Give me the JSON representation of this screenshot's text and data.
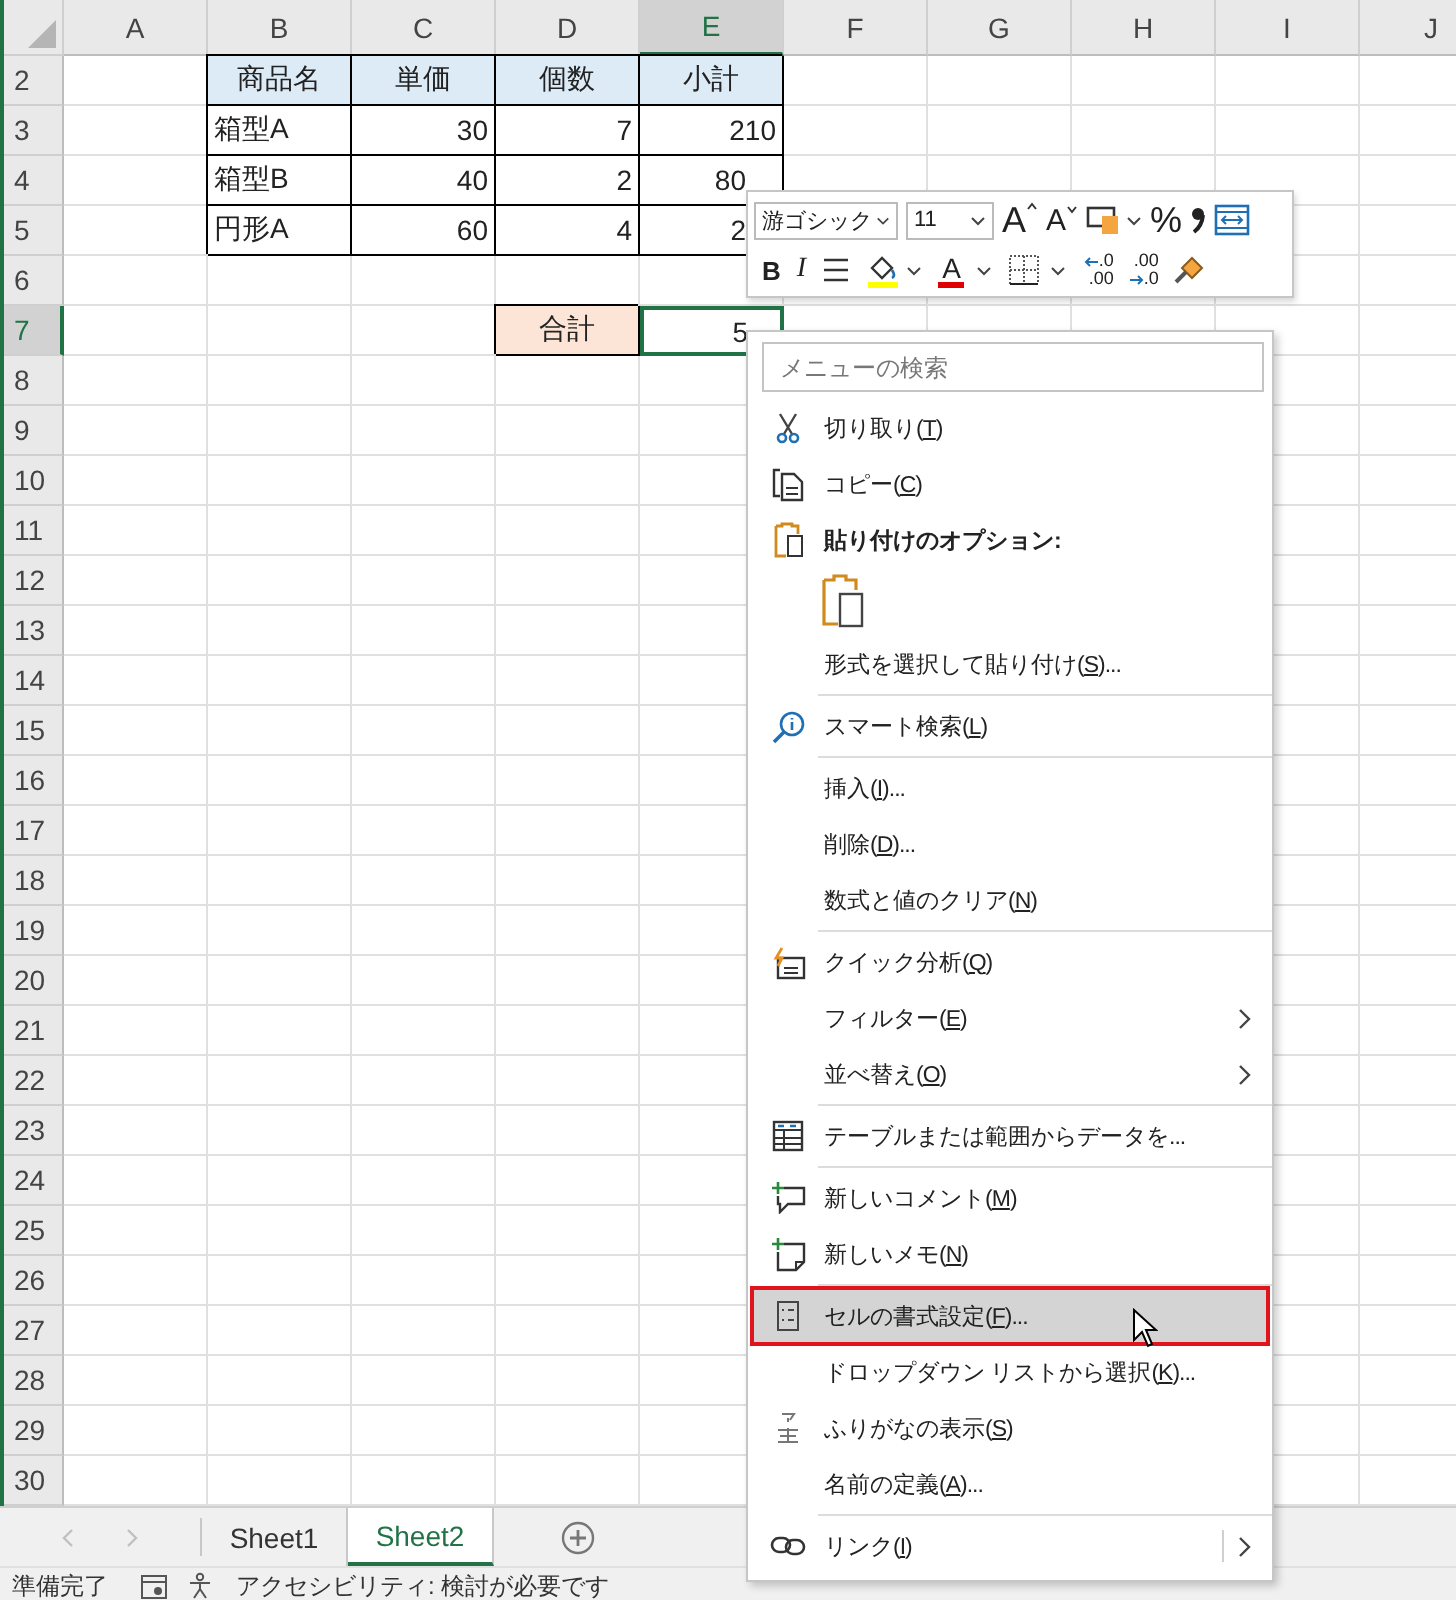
{
  "sheet": {
    "columns": [
      {
        "label": "A",
        "selected": false
      },
      {
        "label": "B",
        "selected": false
      },
      {
        "label": "C",
        "selected": false
      },
      {
        "label": "D",
        "selected": false
      },
      {
        "label": "E",
        "selected": true
      },
      {
        "label": "F",
        "selected": false
      },
      {
        "label": "G",
        "selected": false
      },
      {
        "label": "H",
        "selected": false
      },
      {
        "label": "I",
        "selected": false
      },
      {
        "label": "J",
        "selected": false
      }
    ],
    "rows": [
      {
        "label": "2",
        "selected": false
      },
      {
        "label": "3",
        "selected": false
      },
      {
        "label": "4",
        "selected": false
      },
      {
        "label": "5",
        "selected": false
      },
      {
        "label": "6",
        "selected": false
      },
      {
        "label": "7",
        "selected": true
      },
      {
        "label": "8",
        "selected": false
      },
      {
        "label": "9",
        "selected": false
      },
      {
        "label": "10",
        "selected": false
      },
      {
        "label": "11",
        "selected": false
      },
      {
        "label": "12",
        "selected": false
      },
      {
        "label": "13",
        "selected": false
      },
      {
        "label": "14",
        "selected": false
      },
      {
        "label": "15",
        "selected": false
      },
      {
        "label": "16",
        "selected": false
      },
      {
        "label": "17",
        "selected": false
      },
      {
        "label": "18",
        "selected": false
      },
      {
        "label": "19",
        "selected": false
      },
      {
        "label": "20",
        "selected": false
      },
      {
        "label": "21",
        "selected": false
      },
      {
        "label": "22",
        "selected": false
      },
      {
        "label": "23",
        "selected": false
      },
      {
        "label": "24",
        "selected": false
      },
      {
        "label": "25",
        "selected": false
      },
      {
        "label": "26",
        "selected": false
      },
      {
        "label": "27",
        "selected": false
      },
      {
        "label": "28",
        "selected": false
      },
      {
        "label": "29",
        "selected": false
      },
      {
        "label": "30",
        "selected": false
      }
    ],
    "table": {
      "header": [
        "商品名",
        "単価",
        "個数",
        "小計"
      ],
      "rows": [
        [
          "箱型A",
          "30",
          "7",
          "210"
        ],
        [
          "箱型B",
          "40",
          "2",
          "80"
        ],
        [
          "円形A",
          "60",
          "4",
          "2"
        ]
      ]
    },
    "total": {
      "label": "合計",
      "value": "5",
      "selected": true
    }
  },
  "mini_toolbar": {
    "font": "游ゴシック",
    "size": "11",
    "row_1": [
      {
        "kind": "grow-font",
        "text": "A"
      },
      {
        "kind": "shrink-font",
        "text": "A"
      },
      {
        "kind": "number-format"
      },
      {
        "kind": "percent",
        "text": "%"
      },
      {
        "kind": "comma"
      },
      {
        "kind": "wrap"
      }
    ],
    "row_2": [
      {
        "kind": "bold",
        "text": "B"
      },
      {
        "kind": "italic",
        "text": "I"
      },
      {
        "kind": "align"
      },
      {
        "kind": "fill-color",
        "color": "#ffff00"
      },
      {
        "kind": "font-color",
        "text": "A",
        "color": "#e00000"
      },
      {
        "kind": "borders"
      },
      {
        "kind": "increase-decimal",
        "upper": ".0",
        "lower": ".00"
      },
      {
        "kind": "decrease-decimal",
        "upper": ".00",
        "lower": ".0"
      },
      {
        "kind": "format-painter"
      }
    ]
  },
  "context_menu": {
    "search": {
      "placeholder": "メニューの検索"
    },
    "items": [
      {
        "kind": "cut",
        "label": [
          "切り取り(",
          "T",
          ")"
        ],
        "highlighted": false,
        "submenu": false
      },
      {
        "kind": "copy",
        "label": [
          "コピー(",
          "C",
          ")"
        ],
        "highlighted": false,
        "submenu": false
      },
      {
        "kind": "paste-heading",
        "label": [
          "貼り付けのオプション:"
        ]
      },
      {
        "kind": "paste-option"
      },
      {
        "kind": "plain",
        "label": [
          "形式を選択して貼り付け(",
          "S",
          ")..."
        ],
        "highlighted": false,
        "submenu": false
      },
      {
        "kind": "separator"
      },
      {
        "kind": "smart-lookup",
        "label": [
          "スマート検索(",
          "L",
          ")"
        ],
        "highlighted": false,
        "submenu": false
      },
      {
        "kind": "separator"
      },
      {
        "kind": "plain",
        "label": [
          "挿入(",
          "I",
          ")..."
        ],
        "highlighted": false,
        "submenu": false
      },
      {
        "kind": "plain",
        "label": [
          "削除(",
          "D",
          ")..."
        ],
        "highlighted": false,
        "submenu": false
      },
      {
        "kind": "plain",
        "label": [
          "数式と値のクリア(",
          "N",
          ")"
        ],
        "highlighted": false,
        "submenu": false
      },
      {
        "kind": "separator"
      },
      {
        "kind": "quick-analysis",
        "label": [
          "クイック分析(",
          "Q",
          ")"
        ],
        "highlighted": false,
        "submenu": false
      },
      {
        "kind": "plain",
        "label": [
          "フィルター(",
          "E",
          ")"
        ],
        "highlighted": false,
        "submenu": true
      },
      {
        "kind": "plain",
        "label": [
          "並べ替え(",
          "O",
          ")"
        ],
        "highlighted": false,
        "submenu": true
      },
      {
        "kind": "separator"
      },
      {
        "kind": "table",
        "label": [
          "テーブルまたは範囲からデータを..."
        ],
        "highlighted": false,
        "submenu": false
      },
      {
        "kind": "separator"
      },
      {
        "kind": "comment",
        "label": [
          "新しいコメント(",
          "M",
          ")"
        ],
        "highlighted": false,
        "submenu": false
      },
      {
        "kind": "note",
        "label": [
          "新しいメモ(",
          "N",
          ")"
        ],
        "highlighted": false,
        "submenu": false
      },
      {
        "kind": "separator"
      },
      {
        "kind": "format-cells",
        "label": [
          "セルの書式設定(",
          "F",
          ")..."
        ],
        "highlighted": true,
        "submenu": false
      },
      {
        "kind": "plain",
        "label": [
          "ドロップダウン リストから選択(",
          "K",
          ")..."
        ],
        "highlighted": false,
        "submenu": false
      },
      {
        "kind": "furigana",
        "label": [
          "ふりがなの表示(",
          "S",
          ")"
        ],
        "highlighted": false,
        "submenu": false
      },
      {
        "kind": "plain",
        "label": [
          "名前の定義(",
          "A",
          ")..."
        ],
        "highlighted": false,
        "submenu": false
      },
      {
        "kind": "separator"
      },
      {
        "kind": "link",
        "label": [
          "リンク(",
          "I",
          ")"
        ],
        "highlighted": false,
        "submenu": true
      }
    ]
  },
  "sheet_tabs": [
    {
      "label": "Sheet1",
      "selected": false
    },
    {
      "label": "Sheet2",
      "selected": true
    }
  ],
  "status_bar": {
    "ready": "準備完了",
    "accessibility": "アクセシビリティ: 検討が必要です"
  }
}
